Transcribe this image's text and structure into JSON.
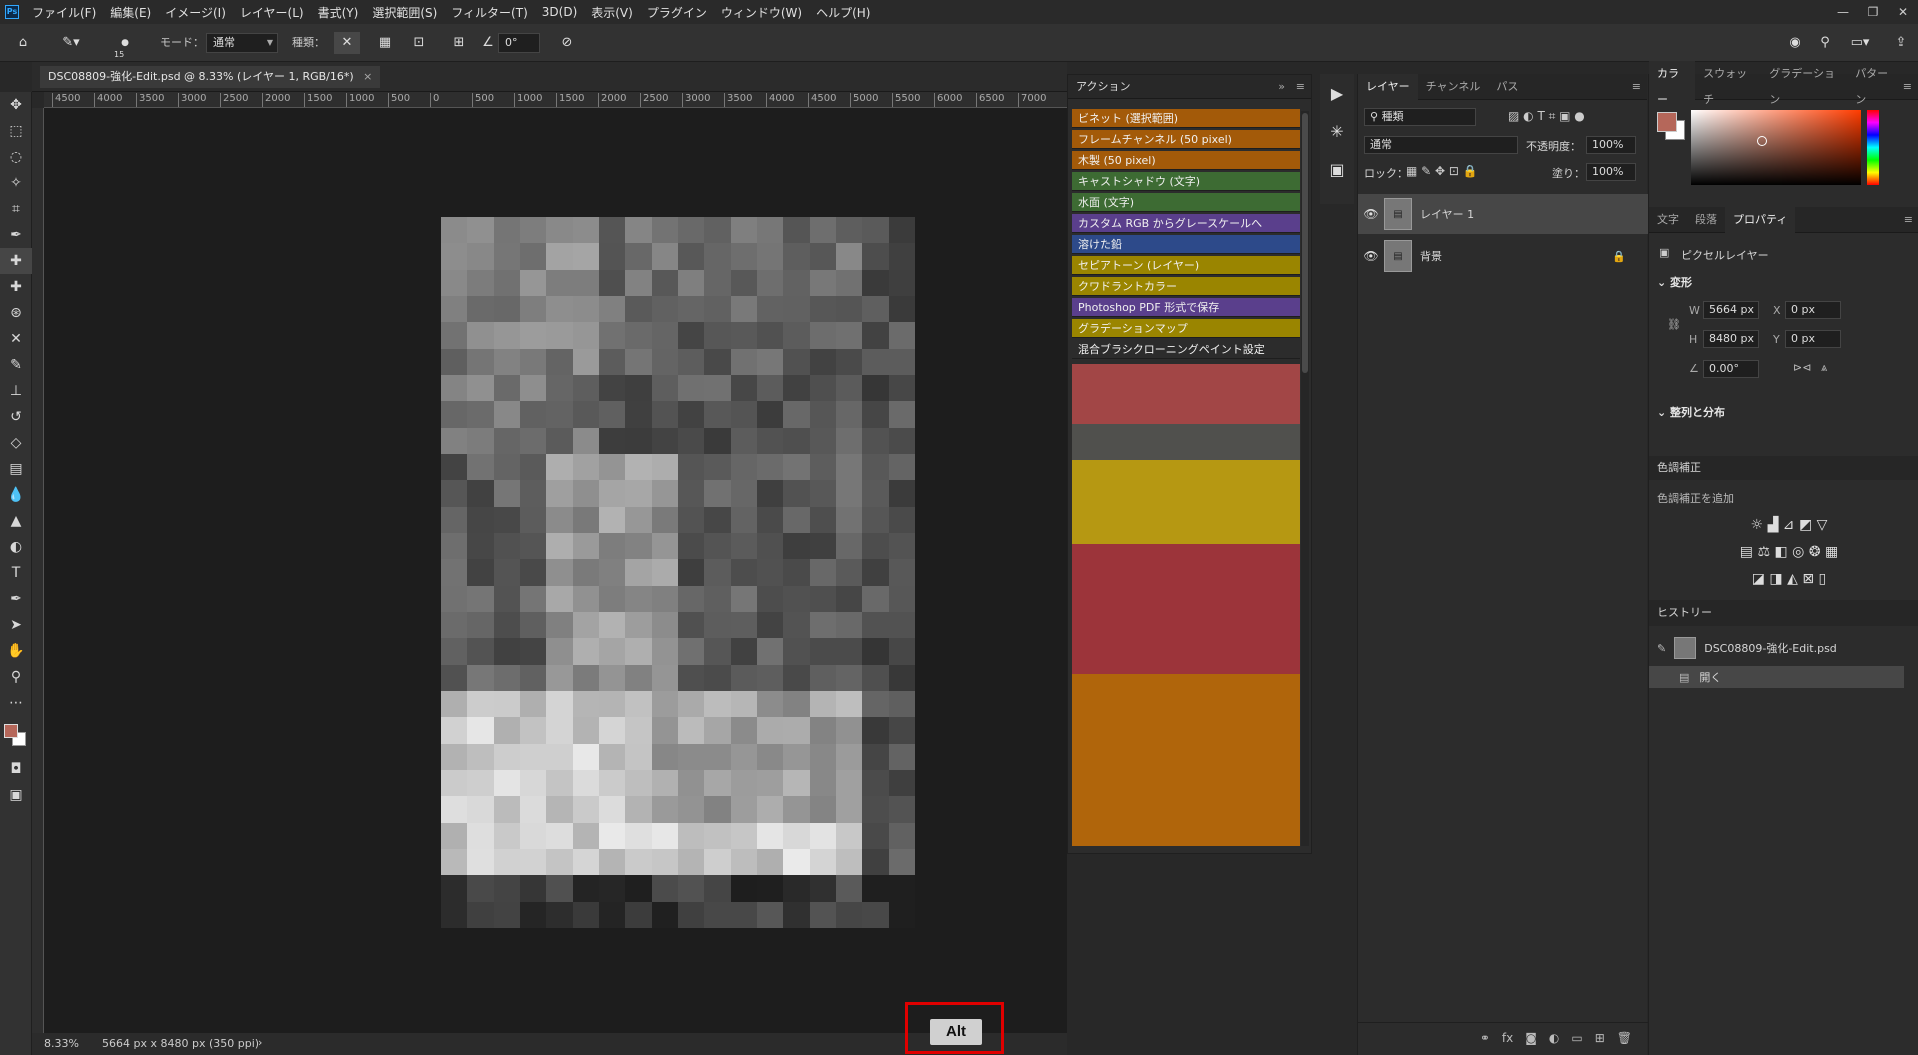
{
  "menubar": {
    "logo": "Ps",
    "items": [
      "ファイル(F)",
      "編集(E)",
      "イメージ(I)",
      "レイヤー(L)",
      "書式(Y)",
      "選択範囲(S)",
      "フィルター(T)",
      "3D(D)",
      "表示(V)",
      "プラグイン",
      "ウィンドウ(W)",
      "ヘルプ(H)"
    ]
  },
  "options": {
    "brush_size": "15",
    "mode_label": "モード：",
    "mode_value": "通常",
    "kind_label": "種類：",
    "angle_value": "0°"
  },
  "document": {
    "tab_title": "DSC08809-強化-Edit.psd @ 8.33% (レイヤー 1, RGB/16*)",
    "close": "×"
  },
  "ruler": {
    "h_ticks": [
      "4500",
      "4000",
      "3500",
      "3000",
      "2500",
      "2000",
      "1500",
      "1000",
      "500",
      "0",
      "500",
      "1000",
      "1500",
      "2000",
      "2500",
      "3000",
      "3500",
      "4000",
      "4500",
      "5000",
      "5500",
      "6000",
      "6500",
      "7000"
    ]
  },
  "status": {
    "zoom": "8.33%",
    "doc_info": "5664 px x 8480 px (350 ppi)",
    "arrow": "›"
  },
  "key_overlay": {
    "label": "Alt",
    "highlight_color": "#e00000"
  },
  "actions_panel": {
    "title": "アクション",
    "items": [
      {
        "label": "ビネット (選択範囲)",
        "color": "#a35a09"
      },
      {
        "label": "フレームチャンネル (50 pixel)",
        "color": "#a35a09"
      },
      {
        "label": "木製 (50 pixel)",
        "color": "#a35a09"
      },
      {
        "label": "キャストシャドウ (文字)",
        "color": "#3d6b33"
      },
      {
        "label": "水面 (文字)",
        "color": "#3d6b33"
      },
      {
        "label": "カスタム RGB からグレースケールへ",
        "color": "#5a3f8c"
      },
      {
        "label": "溶けた鉛",
        "color": "#2d4a8a"
      },
      {
        "label": "セピアトーン (レイヤー)",
        "color": "#9a8500"
      },
      {
        "label": "クワドラントカラー",
        "color": "#9a8500"
      },
      {
        "label": "Photoshop PDF 形式で保存",
        "color": "#5a3f8c"
      },
      {
        "label": "グラデーションマップ",
        "color": "#9a8500"
      },
      {
        "label": "混合ブラシクローニングペイント設定",
        "color": "#2c2c2c"
      }
    ]
  },
  "layers_panel": {
    "tabs": [
      "レイヤー",
      "チャンネル",
      "パス"
    ],
    "filter_label": "種類",
    "blend_mode": "通常",
    "opacity_label": "不透明度：",
    "opacity_value": "100%",
    "lock_label": "ロック：",
    "fill_label": "塗り：",
    "fill_value": "100%",
    "layers": [
      {
        "name": "レイヤー 1",
        "selected": true,
        "locked": false
      },
      {
        "name": "背景",
        "selected": false,
        "locked": true
      }
    ]
  },
  "color_panel": {
    "tabs": [
      "カラー",
      "スウォッチ",
      "グラデーション",
      "パターン"
    ],
    "foreground": "#b5675a",
    "background": "#ffffff"
  },
  "properties_panel": {
    "tabs": [
      "文字",
      "段落",
      "プロパティ"
    ],
    "layer_type": "ピクセルレイヤー",
    "transform_title": "変形",
    "w_label": "W",
    "w_value": "5664 px",
    "h_label": "H",
    "h_value": "8480 px",
    "x_label": "X",
    "x_value": "0 px",
    "y_label": "Y",
    "y_value": "0 px",
    "angle_value": "0.00°",
    "align_title": "整列と分布"
  },
  "adjustments_panel": {
    "title": "色調補正",
    "add_label": "色調補正を追加"
  },
  "history_panel": {
    "title": "ヒストリー",
    "snapshot": "DSC08809-強化-Edit.psd",
    "items": [
      "開く"
    ]
  }
}
